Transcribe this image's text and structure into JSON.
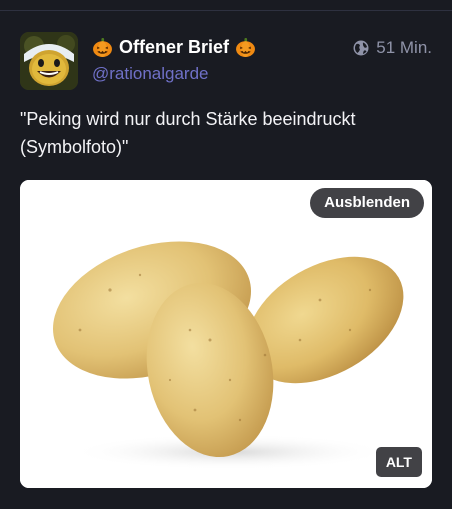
{
  "post": {
    "display_name": "Offener Brief",
    "name_icons": [
      "pumpkin-emoji",
      "pumpkin-emoji"
    ],
    "handle": "@rationalgarde",
    "visibility_icon": "globe-icon",
    "timestamp": "51 Min.",
    "text": "\"Peking wird nur durch Stärke beeindruckt (Symbolfoto)\"",
    "media": {
      "image_subject": "potatoes",
      "hide_label": "Ausblenden",
      "alt_label": "ALT"
    }
  },
  "colors": {
    "background": "#191b22",
    "handle": "#8c8dff",
    "muted": "#8f93a8",
    "text": "#f3f3f6",
    "badge": "#28282c"
  }
}
